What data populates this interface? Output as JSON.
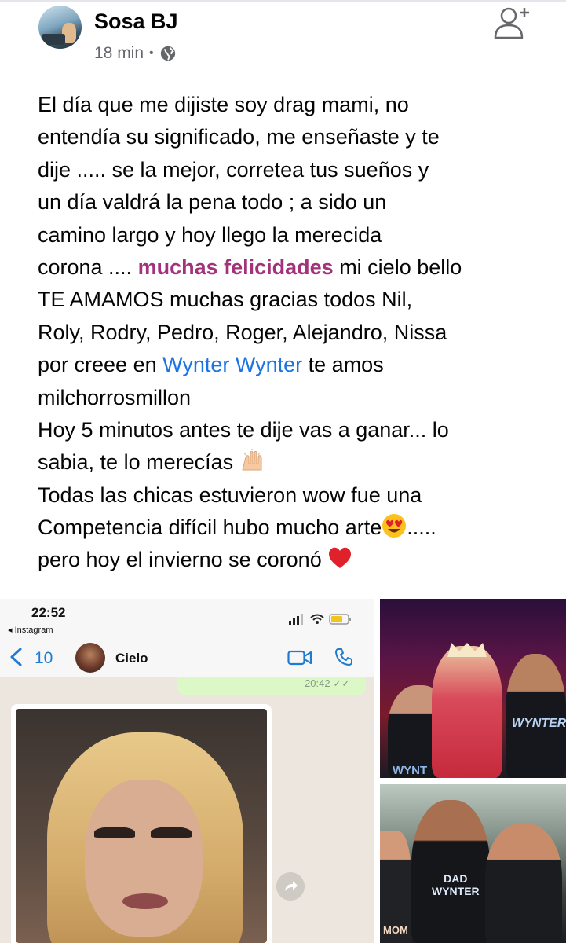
{
  "post": {
    "author": "Sosa BJ",
    "time": "18 min",
    "separator": "•",
    "privacy_icon": "globe-icon",
    "action_icon": "add-friend-icon",
    "lines": [
      "El día que me dijiste soy drag mami, no",
      "entendía su significado, me enseñaste y te",
      "dije ..... se la mejor, corretea tus sueños y",
      "un día valdrá la pena todo ; a sido un",
      "camino largo y hoy llego la merecida",
      {
        "before": "corona .... ",
        "tag": "muchas felicidades",
        "after": " mi cielo bello"
      },
      "TE AMAMOS muchas gracias todos Nil,",
      "Roly, Rodry, Pedro, Roger, Alejandro, Nissa",
      {
        "before": "por creee en ",
        "tag": "Wynter Wynter",
        "after": " te amos"
      },
      "milchorrosmillon",
      "Hoy 5 minutos antes te dije vas a ganar... lo",
      {
        "text": "sabia, te lo merecías ",
        "emoji": "raising-hands-emoji"
      },
      "Todas las chicas estuvieron wow fue una",
      {
        "text": "Competencia difícil hubo mucho arte",
        "emoji": "heart-eyes-emoji",
        "after": "....."
      },
      {
        "text": "pero hoy el invierno se coronó ",
        "emoji": "red-heart-emoji"
      }
    ],
    "colors": {
      "profile_tag": "#a2337b",
      "page_tag": "#1b74e4",
      "meta": "#65676b"
    }
  },
  "screenshot": {
    "time": "22:52",
    "back_app": "◂ Instagram",
    "back_count": "10",
    "contact": "Cielo",
    "bubble_time": "20:42 ✓✓",
    "icons": [
      "signal-icon",
      "wifi-icon",
      "battery-icon",
      "video-call-icon",
      "phone-icon",
      "forward-icon"
    ]
  },
  "photos": {
    "top_right_shirt_right": "WYNTER",
    "top_right_shirt_left": "WYNT",
    "bottom_right_shirt_dad_1": "DAD",
    "bottom_right_shirt_dad_2": "WYNTER",
    "bottom_right_shirt_mom": "MOM"
  }
}
